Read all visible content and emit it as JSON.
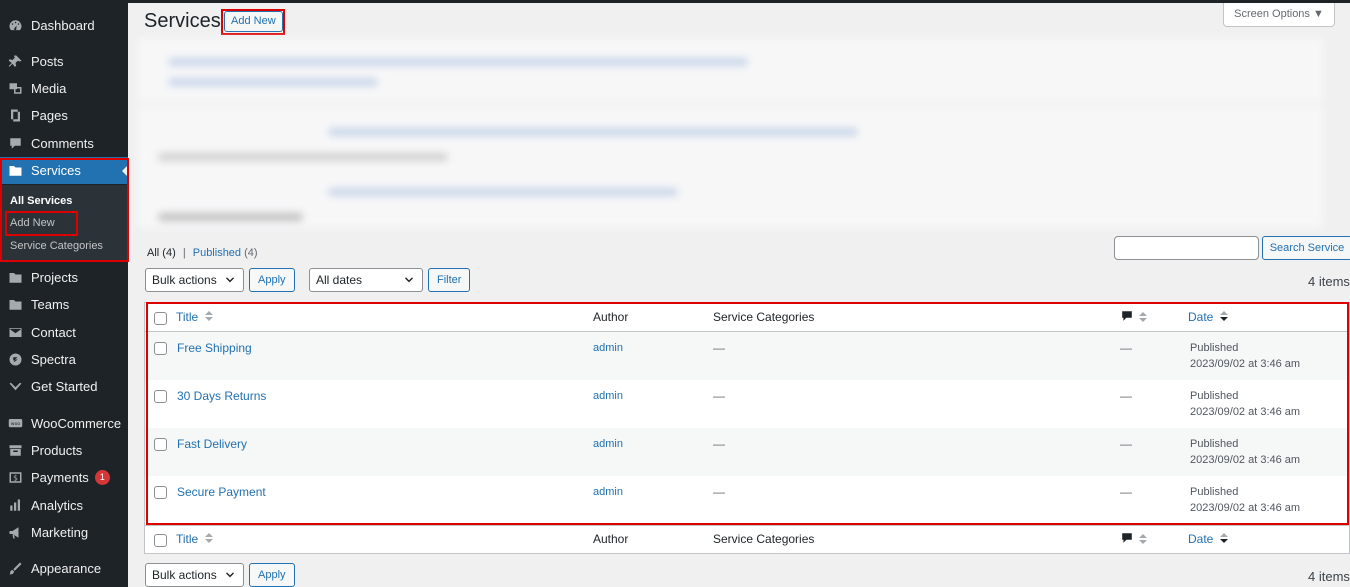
{
  "sidebar": {
    "items": [
      {
        "label": "Dashboard",
        "icon": "dashboard-icon"
      },
      {
        "label": "Posts",
        "icon": "pin-icon"
      },
      {
        "label": "Media",
        "icon": "media-icon"
      },
      {
        "label": "Pages",
        "icon": "pages-icon"
      },
      {
        "label": "Comments",
        "icon": "comment-icon"
      },
      {
        "label": "Services",
        "icon": "folder-icon"
      },
      {
        "label": "Projects",
        "icon": "folder-icon"
      },
      {
        "label": "Teams",
        "icon": "folder-icon"
      },
      {
        "label": "Contact",
        "icon": "mail-icon"
      },
      {
        "label": "Spectra",
        "icon": "spectra-icon"
      },
      {
        "label": "Get Started",
        "icon": "check-icon"
      },
      {
        "label": "WooCommerce",
        "icon": "woo-icon"
      },
      {
        "label": "Products",
        "icon": "archive-icon"
      },
      {
        "label": "Payments",
        "icon": "dollar-icon",
        "badge": "1"
      },
      {
        "label": "Analytics",
        "icon": "bar-chart-icon"
      },
      {
        "label": "Marketing",
        "icon": "megaphone-icon"
      },
      {
        "label": "Appearance",
        "icon": "brush-icon"
      }
    ],
    "submenu": [
      "All Services",
      "Add New",
      "Service Categories"
    ]
  },
  "header": {
    "title": "Services",
    "add_new": "Add New",
    "screen_options": "Screen Options"
  },
  "filters": {
    "all_label": "All",
    "all_count": "(4)",
    "separator": "|",
    "published_label": "Published",
    "published_count": "(4)"
  },
  "search": {
    "button": "Search Service",
    "value": ""
  },
  "tablenav_top": {
    "bulk_actions": "Bulk actions",
    "apply": "Apply",
    "dates": "All dates",
    "filter": "Filter",
    "items_count": "4 items"
  },
  "tablenav_bottom": {
    "bulk_actions": "Bulk actions",
    "apply": "Apply",
    "items_count": "4 items"
  },
  "table": {
    "columns": {
      "title": "Title",
      "author": "Author",
      "categories": "Service Categories",
      "date": "Date"
    },
    "rows": [
      {
        "title": "Free Shipping",
        "author": "admin",
        "categories": "—",
        "comments": "—",
        "status": "Published",
        "date": "2023/09/02 at 3:46 am"
      },
      {
        "title": "30 Days Returns",
        "author": "admin",
        "categories": "—",
        "comments": "—",
        "status": "Published",
        "date": "2023/09/02 at 3:46 am"
      },
      {
        "title": "Fast Delivery",
        "author": "admin",
        "categories": "—",
        "comments": "—",
        "status": "Published",
        "date": "2023/09/02 at 3:46 am"
      },
      {
        "title": "Secure Payment",
        "author": "admin",
        "categories": "—",
        "comments": "—",
        "status": "Published",
        "date": "2023/09/02 at 3:46 am"
      }
    ]
  },
  "colors": {
    "sidebar_bg": "#1d2327",
    "accent": "#2271b1",
    "highlight": "#dd0000"
  }
}
